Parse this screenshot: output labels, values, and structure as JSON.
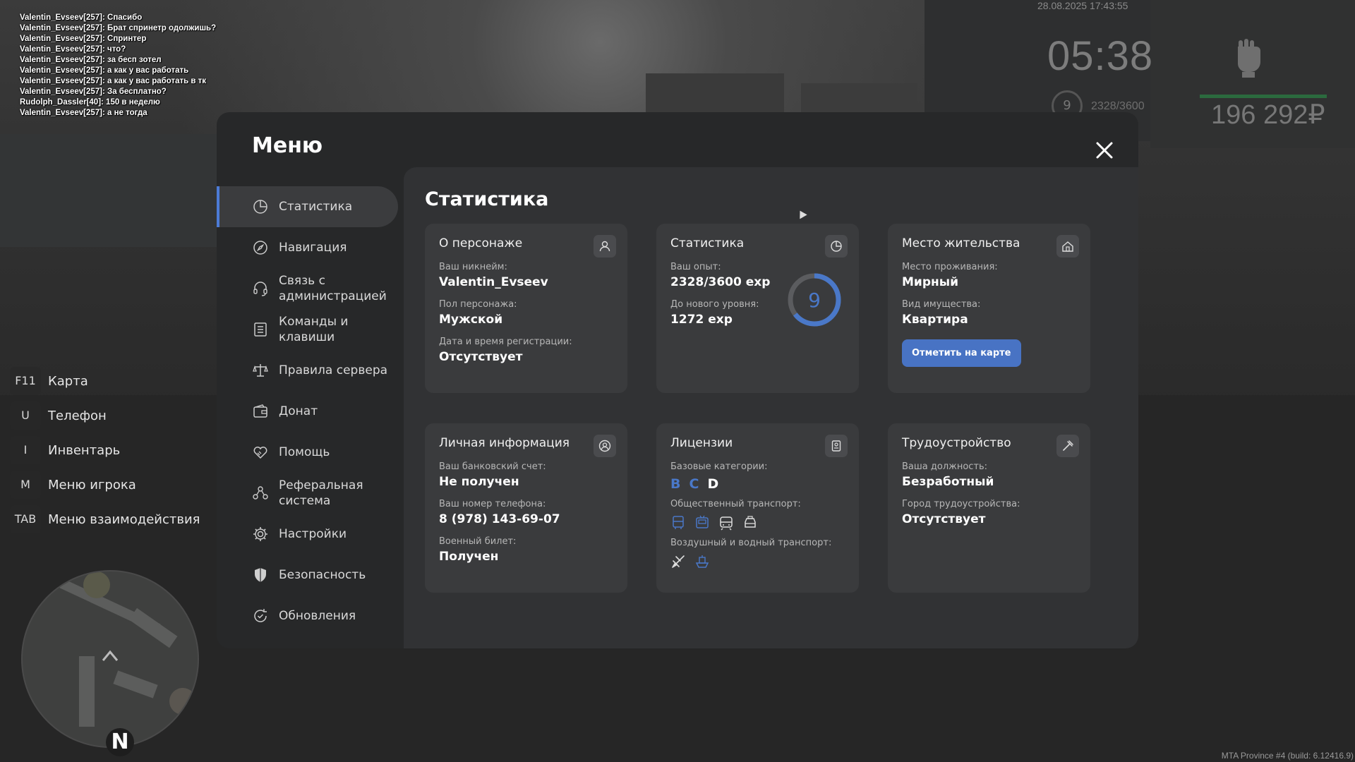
{
  "chat": [
    "Valentin_Evseev[257]: Спасибо",
    "Valentin_Evseev[257]: Брат спринетр одолжишь?",
    "Valentin_Evseev[257]: Спринтер",
    "Valentin_Evseev[257]: что?",
    "Valentin_Evseev[257]: за бесп зотел",
    "Valentin_Evseev[257]: а как у вас работать",
    "Valentin_Evseev[257]: а как у вас работать в тк",
    "Valentin_Evseev[257]: За бесплатно?",
    "Rudolph_Dassler[40]: 150 в неделю",
    "Valentin_Evseev[257]: а не тогда"
  ],
  "hud": {
    "datetime": "28.08.2025 17:43:55",
    "time": "05:38",
    "level": "9",
    "exp": "2328/3600",
    "money": "196 292₽",
    "build": "MTA Province #4 (build: 6.12416.9)"
  },
  "hotkeys": [
    {
      "key": "F11",
      "label": "Карта"
    },
    {
      "key": "U",
      "label": "Телефон"
    },
    {
      "key": "I",
      "label": "Инвентарь"
    },
    {
      "key": "M",
      "label": "Меню игрока"
    },
    {
      "key": "TAB",
      "label": "Меню взаимодействия"
    }
  ],
  "minimap": {
    "north": "N"
  },
  "menu": {
    "title": "Меню",
    "nav": [
      {
        "label": "Статистика",
        "icon": "chart-pie-icon",
        "active": true
      },
      {
        "label": "Навигация",
        "icon": "compass-icon"
      },
      {
        "label": "Связь с\nадминистрацией",
        "icon": "headset-icon"
      },
      {
        "label": "Команды и\nклавиши",
        "icon": "document-list-icon"
      },
      {
        "label": "Правила сервера",
        "icon": "scales-icon"
      },
      {
        "label": "Донат",
        "icon": "wallet-icon"
      },
      {
        "label": "Помощь",
        "icon": "handshake-heart-icon"
      },
      {
        "label": "Реферальная\nсистема",
        "icon": "referral-icon"
      },
      {
        "label": "Настройки",
        "icon": "gear-icon"
      },
      {
        "label": "Безопасность",
        "icon": "shield-icon"
      },
      {
        "label": "Обновления",
        "icon": "refresh-check-icon"
      }
    ]
  },
  "stats": {
    "title": "Статистика",
    "character": {
      "title": "О персонаже",
      "nick_label": "Ваш никнейм:",
      "nick": "Valentin_Evseev",
      "gender_label": "Пол персонажа:",
      "gender": "Мужской",
      "reg_label": "Дата и время регистрации:",
      "reg": "Отсутствует"
    },
    "statistics": {
      "title": "Статистика",
      "exp_label": "Ваш опыт:",
      "exp": "2328/3600 exp",
      "next_label": "До нового уровня:",
      "next": "1272 exp",
      "level": "9",
      "progress": 0.6467,
      "ring_color": "#4a78c8"
    },
    "residence": {
      "title": "Место жительства",
      "place_label": "Место проживания:",
      "place": "Мирный",
      "type_label": "Вид имущества:",
      "type": "Квартира",
      "button": "Отметить на карте"
    },
    "personal": {
      "title": "Личная информация",
      "bank_label": "Ваш банковский счет:",
      "bank": "Не получен",
      "phone_label": "Ваш номер телефона:",
      "phone": "8 (978) 143-69-07",
      "military_label": "Военный билет:",
      "military": "Получен"
    },
    "licenses": {
      "title": "Лицензии",
      "base_label": "Базовые категории:",
      "categories": [
        {
          "letter": "B",
          "color": "#4a78c8"
        },
        {
          "letter": "C",
          "color": "#4a78c8"
        },
        {
          "letter": "D",
          "color": "#ffffff"
        }
      ],
      "public_label": "Общественный транспорт:",
      "air_label": "Воздушный и водный транспорт:"
    },
    "employment": {
      "title": "Трудоустройство",
      "position_label": "Ваша должность:",
      "position": "Безработный",
      "city_label": "Город трудоустройства:",
      "city": "Отсутствует"
    }
  }
}
